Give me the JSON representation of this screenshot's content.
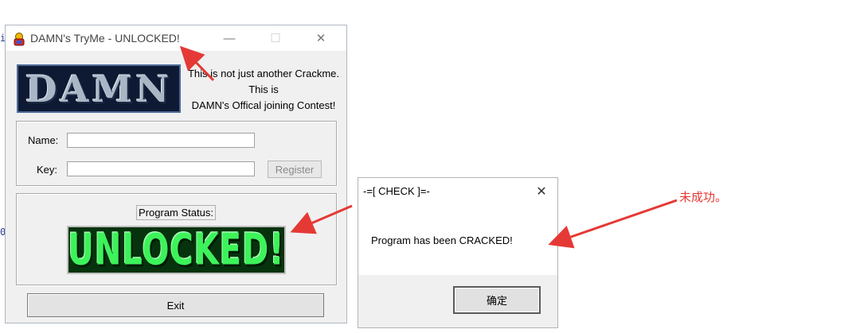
{
  "edge_glyphs": [
    "i",
    "0"
  ],
  "main_window": {
    "title": "DAMN's TryMe - UNLOCKED!",
    "controls": {
      "minimize": "—",
      "maximize": "☐",
      "close": "✕"
    },
    "logo_text": "DAMN",
    "tagline": [
      "This is not just another Crackme.",
      "This is",
      "DAMN's Offical joining Contest!"
    ],
    "name_label": "Name:",
    "name_value": "",
    "key_label": "Key:",
    "key_value": "",
    "register_label": "Register",
    "status_label": "Program Status:",
    "status_banner": "UNLOCKED!",
    "exit_label": "Exit"
  },
  "dialog": {
    "title": "-=[ CHECK ]=-",
    "close": "✕",
    "message": "Program has been CRACKED!",
    "ok_label": "确定"
  },
  "annotation": {
    "note": "未成功。",
    "arrow_color": "#e53935"
  }
}
